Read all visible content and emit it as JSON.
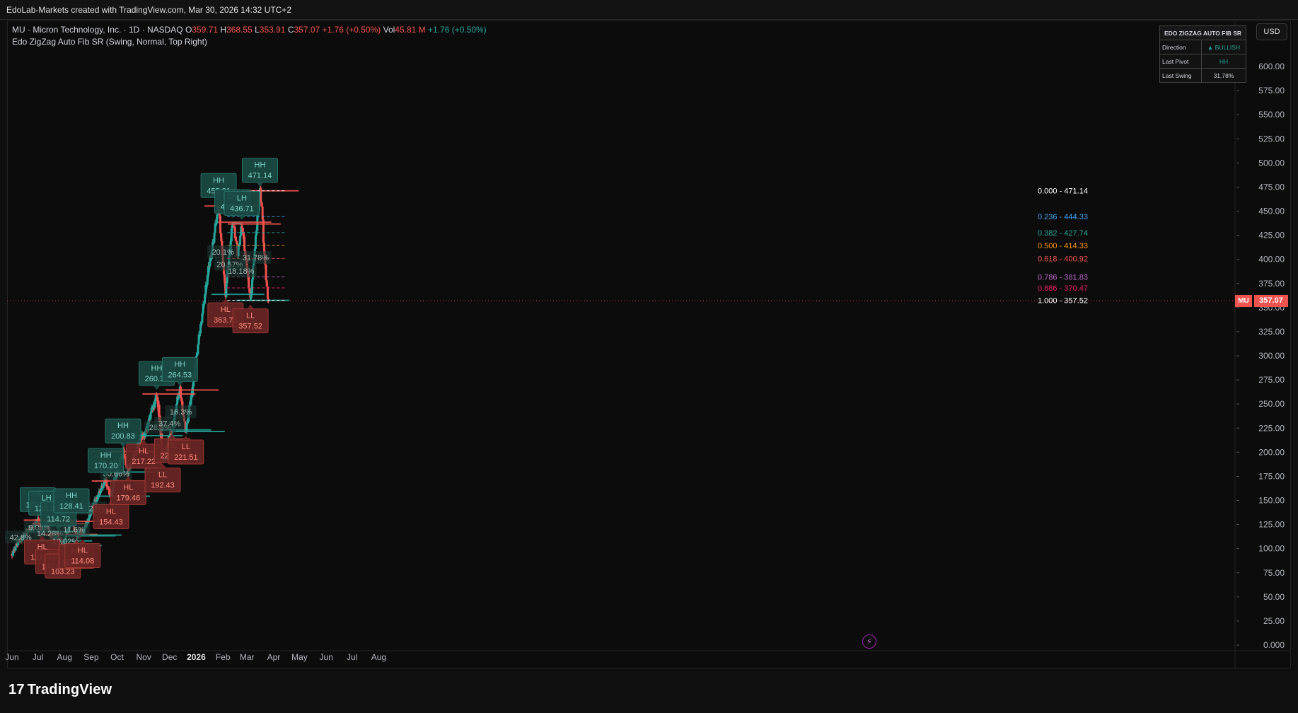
{
  "header": {
    "attribution": "EdoLab-Markets created with TradingView.com, Mar 30, 2026 14:32 UTC+2"
  },
  "legend": {
    "symbol": "MU · Micron Technology, Inc. · 1D · NASDAQ",
    "open_label": "O",
    "open": "359.71",
    "high_label": "H",
    "high": "368.55",
    "low_label": "L",
    "low": "353.91",
    "close_label": "C",
    "close": "357.07",
    "change": "+1.76 (+0.50%)",
    "vol_label": "Vol",
    "vol": "45.81 M",
    "vol_change": "+1.76 (+0.50%)",
    "indicator": "Edo ZigZag Auto Fib SR (Swing, Normal, Top Right)"
  },
  "currency_button": "USD",
  "info_table": {
    "title": "EDO ZIGZAG AUTO FIB SR",
    "rows": [
      {
        "label": "Direction",
        "value": "▲ BULLISH"
      },
      {
        "label": "Last Pivot",
        "value": "HH"
      },
      {
        "label": "Last Swing",
        "value": "31.78%"
      }
    ]
  },
  "last_price_tag": {
    "symbol": "MU",
    "price": "357.07"
  },
  "footer": {
    "logo_mark": "17",
    "logo_text": "TradingView"
  },
  "colors": {
    "bull": "#26a69a",
    "bear": "#ef5350",
    "background": "#0c0c0c"
  },
  "chart_data": {
    "type": "candlestick-zigzag",
    "y_ticks": [
      "0.000",
      "25.00",
      "50.00",
      "75.00",
      "100.00",
      "125.00",
      "150.00",
      "175.00",
      "200.00",
      "225.00",
      "250.00",
      "275.00",
      "300.00",
      "325.00",
      "350.00",
      "375.00",
      "400.00",
      "425.00",
      "450.00",
      "475.00",
      "500.00",
      "525.00",
      "550.00",
      "575.00",
      "600.00"
    ],
    "ylim": [
      0,
      600
    ],
    "x_ticks": [
      {
        "label": "Jun",
        "day": 0
      },
      {
        "label": "Jul",
        "day": 30
      },
      {
        "label": "Aug",
        "day": 61
      },
      {
        "label": "Sep",
        "day": 92
      },
      {
        "label": "Oct",
        "day": 122
      },
      {
        "label": "Nov",
        "day": 153
      },
      {
        "label": "Dec",
        "day": 183
      },
      {
        "label": "2026",
        "day": 214
      },
      {
        "label": "Feb",
        "day": 245
      },
      {
        "label": "Mar",
        "day": 273
      },
      {
        "label": "Apr",
        "day": 304
      },
      {
        "label": "May",
        "day": 334
      },
      {
        "label": "Jun",
        "day": 365
      },
      {
        "label": "Jul",
        "day": 395
      },
      {
        "label": "Aug",
        "day": 426
      }
    ],
    "price_path": [
      [
        0,
        95
      ],
      [
        6,
        105
      ],
      [
        12,
        112
      ],
      [
        18,
        118
      ],
      [
        24,
        123
      ],
      [
        28,
        127
      ],
      [
        30,
        129.54
      ],
      [
        33,
        118
      ],
      [
        35,
        117.78
      ],
      [
        37,
        122
      ],
      [
        40,
        125.97
      ],
      [
        43,
        118
      ],
      [
        46,
        111
      ],
      [
        48,
        107.97
      ],
      [
        51,
        112
      ],
      [
        54,
        114.72
      ],
      [
        57,
        108
      ],
      [
        59,
        103.23
      ],
      [
        62,
        112
      ],
      [
        66,
        123
      ],
      [
        69,
        128.41
      ],
      [
        72,
        120
      ],
      [
        75,
        113.3
      ],
      [
        79,
        118
      ],
      [
        82,
        114.08
      ],
      [
        86,
        125
      ],
      [
        90,
        135
      ],
      [
        94,
        145
      ],
      [
        98,
        152
      ],
      [
        102,
        160
      ],
      [
        106,
        166
      ],
      [
        109,
        170.2
      ],
      [
        112,
        160
      ],
      [
        115,
        154.43
      ],
      [
        118,
        168
      ],
      [
        122,
        180
      ],
      [
        126,
        192
      ],
      [
        129,
        200.83
      ],
      [
        132,
        190
      ],
      [
        135,
        179.46
      ],
      [
        139,
        190
      ],
      [
        143,
        200
      ],
      [
        147,
        210
      ],
      [
        150,
        215
      ],
      [
        153,
        217.22
      ],
      [
        157,
        225
      ],
      [
        161,
        240
      ],
      [
        165,
        250
      ],
      [
        168,
        260.37
      ],
      [
        171,
        240
      ],
      [
        174,
        205
      ],
      [
        175,
        192.43
      ],
      [
        178,
        200
      ],
      [
        182,
        215
      ],
      [
        186,
        223.15
      ],
      [
        189,
        240
      ],
      [
        192,
        255
      ],
      [
        195,
        264.53
      ],
      [
        198,
        245
      ],
      [
        200,
        230
      ],
      [
        202,
        221.51
      ],
      [
        205,
        240
      ],
      [
        209,
        262
      ],
      [
        213,
        290
      ],
      [
        217,
        318
      ],
      [
        221,
        345
      ],
      [
        225,
        370
      ],
      [
        229,
        395
      ],
      [
        233,
        415
      ],
      [
        237,
        440
      ],
      [
        240,
        455.31
      ],
      [
        243,
        420
      ],
      [
        246,
        385
      ],
      [
        248,
        363.75
      ],
      [
        250,
        385
      ],
      [
        253,
        410
      ],
      [
        256,
        438.59
      ],
      [
        259,
        425
      ],
      [
        262,
        405
      ],
      [
        264,
        420
      ],
      [
        267,
        436.71
      ],
      [
        269,
        420
      ],
      [
        272,
        395
      ],
      [
        275,
        375
      ],
      [
        277,
        357.52
      ],
      [
        280,
        390
      ],
      [
        283,
        420
      ],
      [
        286,
        455
      ],
      [
        288,
        471.14
      ],
      [
        290,
        455
      ],
      [
        292,
        420
      ],
      [
        294,
        390
      ],
      [
        296,
        370
      ],
      [
        298,
        357.07
      ]
    ],
    "pivots": [
      {
        "type": "HH",
        "value": "129.54",
        "day": 30,
        "price": 129.54,
        "up": true
      },
      {
        "type": "HL",
        "value": "117.78",
        "day": 35,
        "price": 117.78,
        "up": false
      },
      {
        "type": "LH",
        "value": "125.97",
        "day": 40,
        "price": 125.97,
        "up": true
      },
      {
        "type": "LL",
        "value": "107.97",
        "day": 48,
        "price": 107.97,
        "up": false
      },
      {
        "type": "LH",
        "value": "114.72",
        "day": 54,
        "price": 114.72,
        "up": true
      },
      {
        "type": "LL",
        "value": "103.23",
        "day": 59,
        "price": 103.23,
        "up": false
      },
      {
        "type": "HH",
        "value": "128.41",
        "day": 69,
        "price": 128.41,
        "up": true
      },
      {
        "type": "HL",
        "value": "113.30",
        "day": 75,
        "price": 113.3,
        "up": false
      },
      {
        "type": "HL",
        "value": "114.08",
        "day": 82,
        "price": 114.08,
        "up": false
      },
      {
        "type": "HH",
        "value": "170.20",
        "day": 109,
        "price": 170.2,
        "up": true
      },
      {
        "type": "HL",
        "value": "154.43",
        "day": 115,
        "price": 154.43,
        "up": false
      },
      {
        "type": "HH",
        "value": "200.83",
        "day": 129,
        "price": 200.83,
        "up": true
      },
      {
        "type": "HL",
        "value": "179.46",
        "day": 135,
        "price": 179.46,
        "up": false
      },
      {
        "type": "HL",
        "value": "217.22",
        "day": 153,
        "price": 217.22,
        "up": false
      },
      {
        "type": "HH",
        "value": "260.37",
        "day": 168,
        "price": 260.37,
        "up": true
      },
      {
        "type": "LL",
        "value": "192.43",
        "day": 175,
        "price": 192.43,
        "up": false
      },
      {
        "type": "HL",
        "value": "223.15",
        "day": 186,
        "price": 223.15,
        "up": false
      },
      {
        "type": "HH",
        "value": "264.53",
        "day": 195,
        "price": 264.53,
        "up": true
      },
      {
        "type": "LL",
        "value": "221.51",
        "day": 202,
        "price": 221.51,
        "up": false
      },
      {
        "type": "HH",
        "value": "455.31",
        "day": 240,
        "price": 455.31,
        "up": true
      },
      {
        "type": "HL",
        "value": "363.75",
        "day": 248,
        "price": 363.75,
        "up": false
      },
      {
        "type": "LH",
        "value": "438.59",
        "day": 256,
        "price": 438.59,
        "up": true
      },
      {
        "type": "LH",
        "value": "436.71",
        "day": 267,
        "price": 436.71,
        "up": true
      },
      {
        "type": "LL",
        "value": "357.52",
        "day": 277,
        "price": 357.52,
        "up": false
      },
      {
        "type": "HH",
        "value": "471.14",
        "day": 288,
        "price": 471.14,
        "up": true
      }
    ],
    "swing_labels": [
      {
        "text": "42.8%",
        "day": 10,
        "price": 112
      },
      {
        "text": "9.08%",
        "day": 32,
        "price": 122
      },
      {
        "text": "14.28%",
        "day": 44,
        "price": 116
      },
      {
        "text": "10.02%",
        "day": 62,
        "price": 108
      },
      {
        "text": "11.6%",
        "day": 72,
        "price": 120
      },
      {
        "text": "50.23%",
        "day": 92,
        "price": 142
      },
      {
        "text": "30.66%",
        "day": 121,
        "price": 178
      },
      {
        "text": "28.3%",
        "day": 172,
        "price": 226
      },
      {
        "text": "37.4%",
        "day": 183,
        "price": 230
      },
      {
        "text": "16.3%",
        "day": 196,
        "price": 242
      },
      {
        "text": "20.1%",
        "day": 245,
        "price": 408
      },
      {
        "text": "20.57%",
        "day": 253,
        "price": 395
      },
      {
        "text": "18.18%",
        "day": 266,
        "price": 388
      },
      {
        "text": "31.78%",
        "day": 283,
        "price": 402
      }
    ],
    "fib_levels": [
      {
        "ratio": "0.000",
        "price": "471.14",
        "value": 471.14,
        "color": "#ffffff"
      },
      {
        "ratio": "0.236",
        "price": "444.33",
        "value": 444.33,
        "color": "#42a5f5"
      },
      {
        "ratio": "0.382",
        "price": "427.74",
        "value": 427.74,
        "color": "#26a69a"
      },
      {
        "ratio": "0.500",
        "price": "414.33",
        "value": 414.33,
        "color": "#ff9800"
      },
      {
        "ratio": "0.618",
        "price": "400.92",
        "value": 400.92,
        "color": "#ef5350"
      },
      {
        "ratio": "0.786",
        "price": "381.83",
        "value": 381.83,
        "color": "#ba68c8"
      },
      {
        "ratio": "0.886",
        "price": "370.47",
        "value": 370.47,
        "color": "#e91e63"
      },
      {
        "ratio": "1.000",
        "price": "357.52",
        "value": 357.52,
        "color": "#ffffff"
      }
    ],
    "last_price": 357.07
  }
}
